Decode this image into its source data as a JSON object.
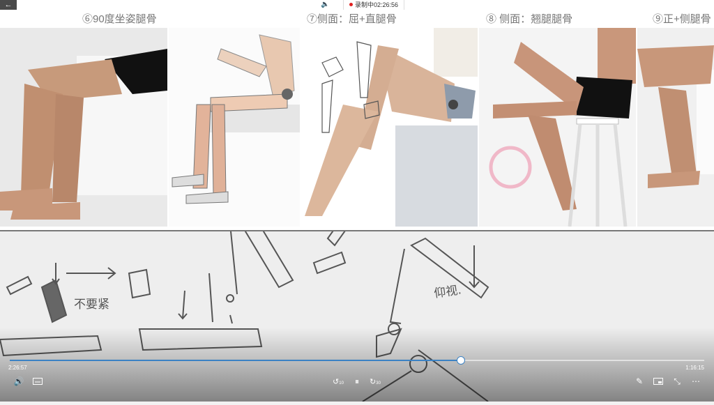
{
  "recording": {
    "label": "录制中",
    "time": "02:26:56"
  },
  "slide_titles": [
    "⑥90度坐姿腿骨",
    "⑦侧面：屈+直腿骨",
    "⑧ 侧面：翘腿腿骨",
    "⑨正+侧腿骨"
  ],
  "sketch_notes": {
    "note1": "不要紧",
    "note2": "仰视."
  },
  "player": {
    "current_time": "2:26:57",
    "total_time": "1:16:15",
    "progress": 0.65,
    "rewind_label": "10",
    "forward_label": "30"
  },
  "colors": {
    "accent": "#3b82c4",
    "record": "#e02020"
  }
}
